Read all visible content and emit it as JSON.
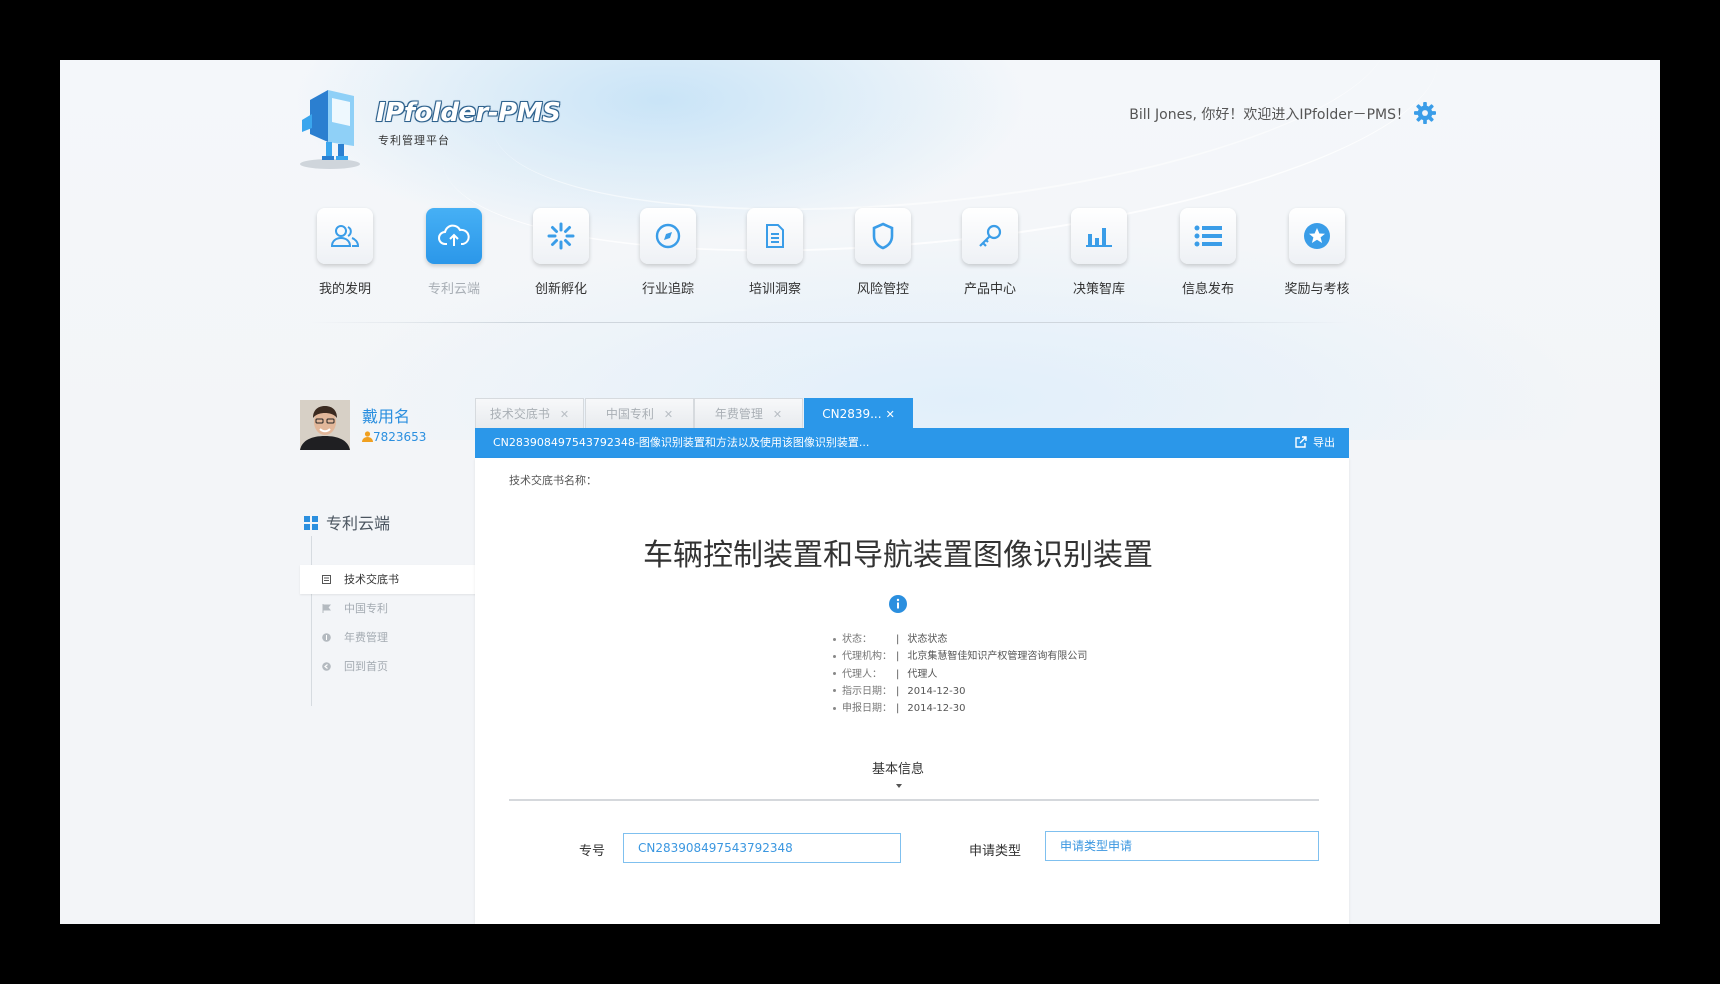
{
  "app": {
    "logo_title": "IPfolder-PMS",
    "logo_subtitle": "专利管理平台",
    "greeting": "Bill Jones, 你好！欢迎进入IPfolder－PMS！",
    "accent_color": "#2b97e9"
  },
  "nav": {
    "items": [
      {
        "label": "我的发明",
        "icon": "users-icon"
      },
      {
        "label": "专利云端",
        "icon": "cloud-upload-icon",
        "active": true
      },
      {
        "label": "创新孵化",
        "icon": "spinner-icon"
      },
      {
        "label": "行业追踪",
        "icon": "compass-icon"
      },
      {
        "label": "培训洞察",
        "icon": "document-icon"
      },
      {
        "label": "风险管控",
        "icon": "shield-icon"
      },
      {
        "label": "产品中心",
        "icon": "key-icon"
      },
      {
        "label": "决策智库",
        "icon": "bar-chart-icon"
      },
      {
        "label": "信息发布",
        "icon": "list-icon"
      },
      {
        "label": "奖励与考核",
        "icon": "star-icon"
      }
    ]
  },
  "profile": {
    "name": "戴用名",
    "id": "7823653"
  },
  "sidebar": {
    "title": "专利云端",
    "items": [
      {
        "label": "技术交底书",
        "active": true
      },
      {
        "label": "中国专利"
      },
      {
        "label": "年费管理"
      },
      {
        "label": "回到首页"
      }
    ]
  },
  "tabs": [
    {
      "label": "技术交底书"
    },
    {
      "label": "中国专利"
    },
    {
      "label": "年费管理"
    },
    {
      "label": "CN2839...",
      "active": true
    }
  ],
  "document": {
    "header": "CN283908497543792348-图像识别装置和方法以及使用该图像识别装置...",
    "export_label": "导出",
    "name_label": "技术交底书名称：",
    "title": "车辆控制装置和导航装置图像识别装置",
    "meta": [
      {
        "key": "状态：",
        "value": "状态状态"
      },
      {
        "key": "代理机构：",
        "value": "北京集慧智佳知识产权管理咨询有限公司"
      },
      {
        "key": "代理人：",
        "value": "代理人"
      },
      {
        "key": "指示日期：",
        "value": "2014-12-30"
      },
      {
        "key": "申报日期：",
        "value": "2014-12-30"
      }
    ],
    "section_title": "基本信息",
    "fields": [
      {
        "label": "专号",
        "value": "CN283908497543792348"
      },
      {
        "label": "申请类型",
        "value": "申请类型申请"
      }
    ]
  }
}
